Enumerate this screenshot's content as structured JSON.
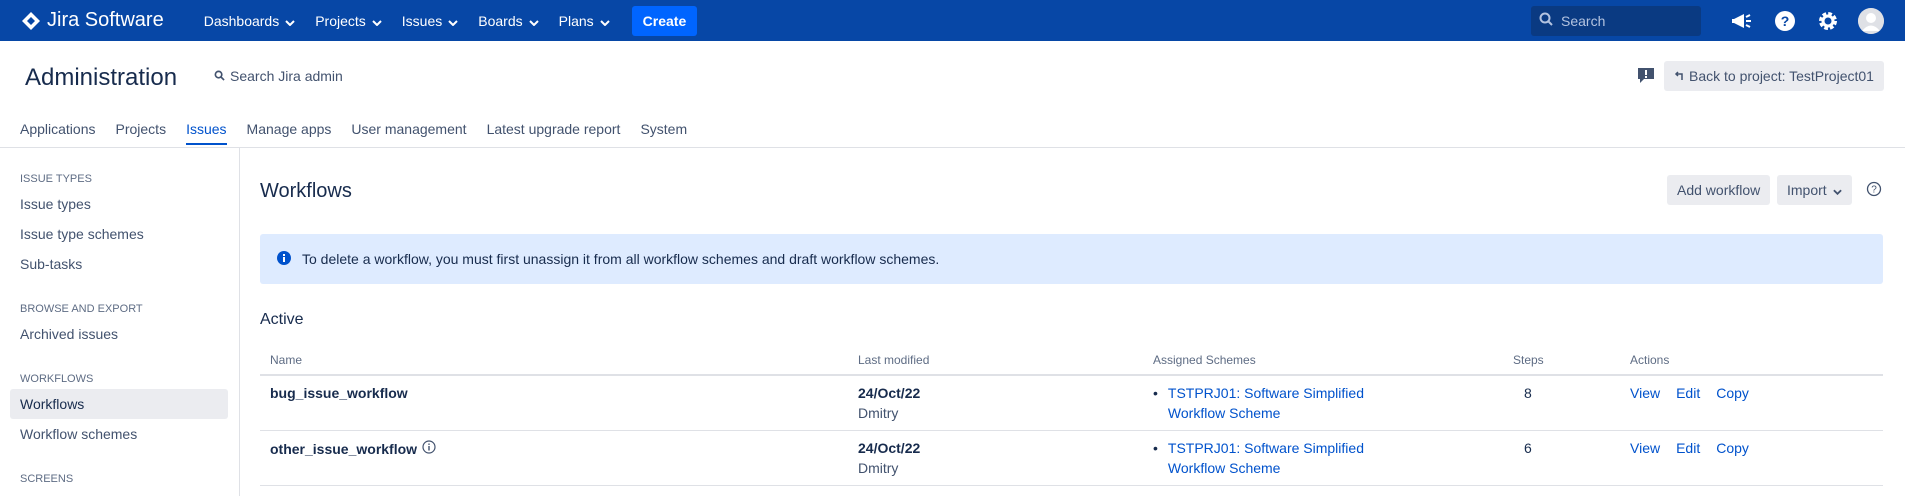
{
  "topnav": {
    "logo_text": "Jira Software",
    "items": [
      {
        "label": "Dashboards"
      },
      {
        "label": "Projects"
      },
      {
        "label": "Issues"
      },
      {
        "label": "Boards"
      },
      {
        "label": "Plans"
      }
    ],
    "create_label": "Create",
    "search_placeholder": "Search",
    "icons": [
      "notifications-icon",
      "help-icon",
      "settings-icon",
      "avatar"
    ],
    "bg_color": "#0747a6",
    "create_color": "#0065ff"
  },
  "admin": {
    "title": "Administration",
    "search_label": "Search Jira admin",
    "back_button": "Back to project: TestProject01",
    "tabs": [
      {
        "label": "Applications"
      },
      {
        "label": "Projects"
      },
      {
        "label": "Issues",
        "active": true
      },
      {
        "label": "Manage apps"
      },
      {
        "label": "User management"
      },
      {
        "label": "Latest upgrade report"
      },
      {
        "label": "System"
      }
    ]
  },
  "sidebar": {
    "sections": [
      {
        "title": "ISSUE TYPES",
        "items": [
          "Issue types",
          "Issue type schemes",
          "Sub-tasks"
        ]
      },
      {
        "title": "BROWSE AND EXPORT",
        "items": [
          "Archived issues"
        ]
      },
      {
        "title": "WORKFLOWS",
        "items": [
          "Workflows",
          "Workflow schemes"
        ]
      },
      {
        "title": "SCREENS",
        "items": []
      }
    ],
    "active_item": "Workflows"
  },
  "main": {
    "title": "Workflows",
    "add_workflow_label": "Add workflow",
    "import_label": "Import",
    "info_message": "To delete a workflow, you must first unassign it from all workflow schemes and draft workflow schemes.",
    "section_title": "Active",
    "table": {
      "columns": [
        "Name",
        "Last modified",
        "Assigned Schemes",
        "Steps",
        "Actions"
      ],
      "rows": [
        {
          "name": "bug_issue_workflow",
          "has_info": false,
          "modified_date": "24/Oct/22",
          "modified_by": "Dmitry",
          "scheme": "TSTPRJ01: Software Simplified Workflow Scheme",
          "steps": "8",
          "actions": [
            "View",
            "Edit",
            "Copy"
          ]
        },
        {
          "name": "other_issue_workflow",
          "has_info": true,
          "modified_date": "24/Oct/22",
          "modified_by": "Dmitry",
          "scheme": "TSTPRJ01: Software Simplified Workflow Scheme",
          "steps": "6",
          "actions": [
            "View",
            "Edit",
            "Copy"
          ]
        }
      ]
    }
  }
}
